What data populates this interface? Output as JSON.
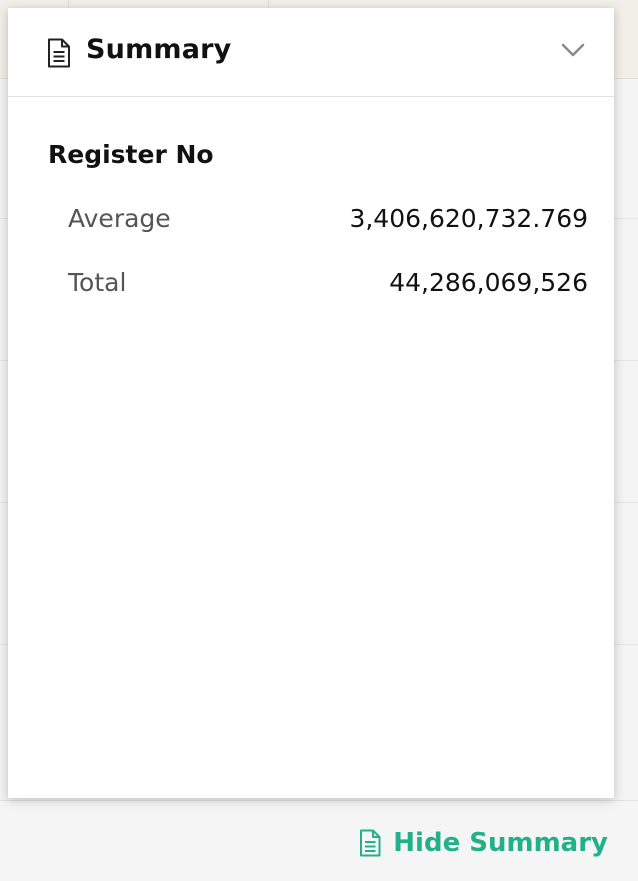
{
  "panel": {
    "title": "Summary",
    "section_title": "Register No",
    "stats": [
      {
        "label": "Average",
        "value": "3,406,620,732.769"
      },
      {
        "label": "Total",
        "value": "44,286,069,526"
      }
    ]
  },
  "footer": {
    "hide_summary_label": "Hide Summary"
  },
  "colors": {
    "accent": "#22b089",
    "panel_bg": "#ffffff",
    "page_bg": "#f4f4f4"
  },
  "icons": {
    "header_icon": "document-icon",
    "collapse_icon": "chevron-down-icon",
    "footer_icon": "document-icon"
  }
}
